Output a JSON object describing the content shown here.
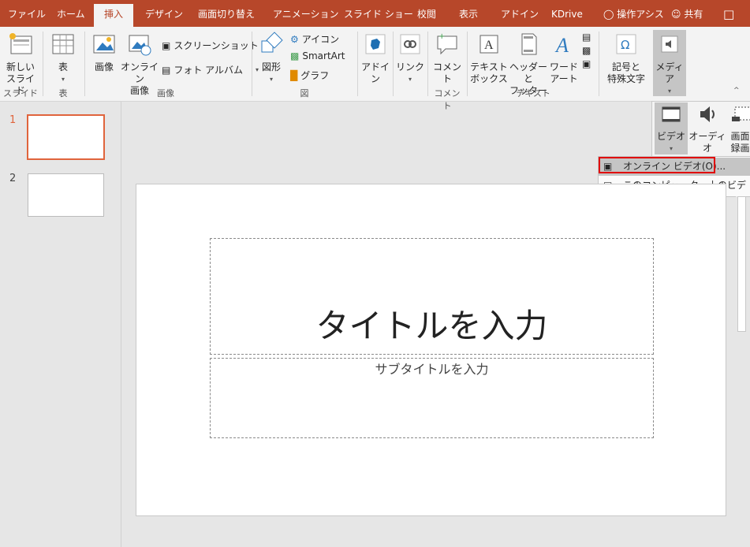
{
  "tabs": [
    "ファイル",
    "ホーム",
    "挿入",
    "デザイン",
    "画面切り替え",
    "アニメーション",
    "スライド ショー",
    "校閲",
    "表示",
    "アドイン",
    "KDrive"
  ],
  "tell_me": "操作アシス",
  "share": "共有",
  "ribbon": {
    "new_slide": "新しい\nスライド",
    "table": "表",
    "picture": "画像",
    "online_picture": "オンライン\n画像",
    "screenshot": "スクリーンショット",
    "photo_album": "フォト アルバム",
    "shapes": "図形",
    "icons": "アイコン",
    "smartart": "SmartArt",
    "chart": "グラフ",
    "addins": "アドイ\nン",
    "link": "リンク",
    "comment": "コメント",
    "textbox": "テキスト\nボックス",
    "header_footer": "ヘッダーと\nフッター",
    "wordart": "ワード\nアート",
    "symbols": "記号と\n特殊文字",
    "media": "メディア",
    "groups": {
      "slides": "スライド",
      "table": "表",
      "images": "画像",
      "illustrations": "図",
      "comments": "コメント",
      "text": "テキスト"
    }
  },
  "media_popup": {
    "video": "ビデオ",
    "audio": "オーディオ",
    "screen_recording": "画面\n録画"
  },
  "video_menu": {
    "online_video": "オンライン ビデオ(O)...",
    "this_computer": "このコンピューター上のビデオ(P)..."
  },
  "thumbnails": [
    "1",
    "2"
  ],
  "slide": {
    "title_placeholder": "タイトルを入力",
    "subtitle_placeholder": "サブタイトルを入力"
  },
  "colors": {
    "accent": "#b7472a",
    "highlight_box": "#e00000",
    "thumb_selected": "#e0643c"
  }
}
